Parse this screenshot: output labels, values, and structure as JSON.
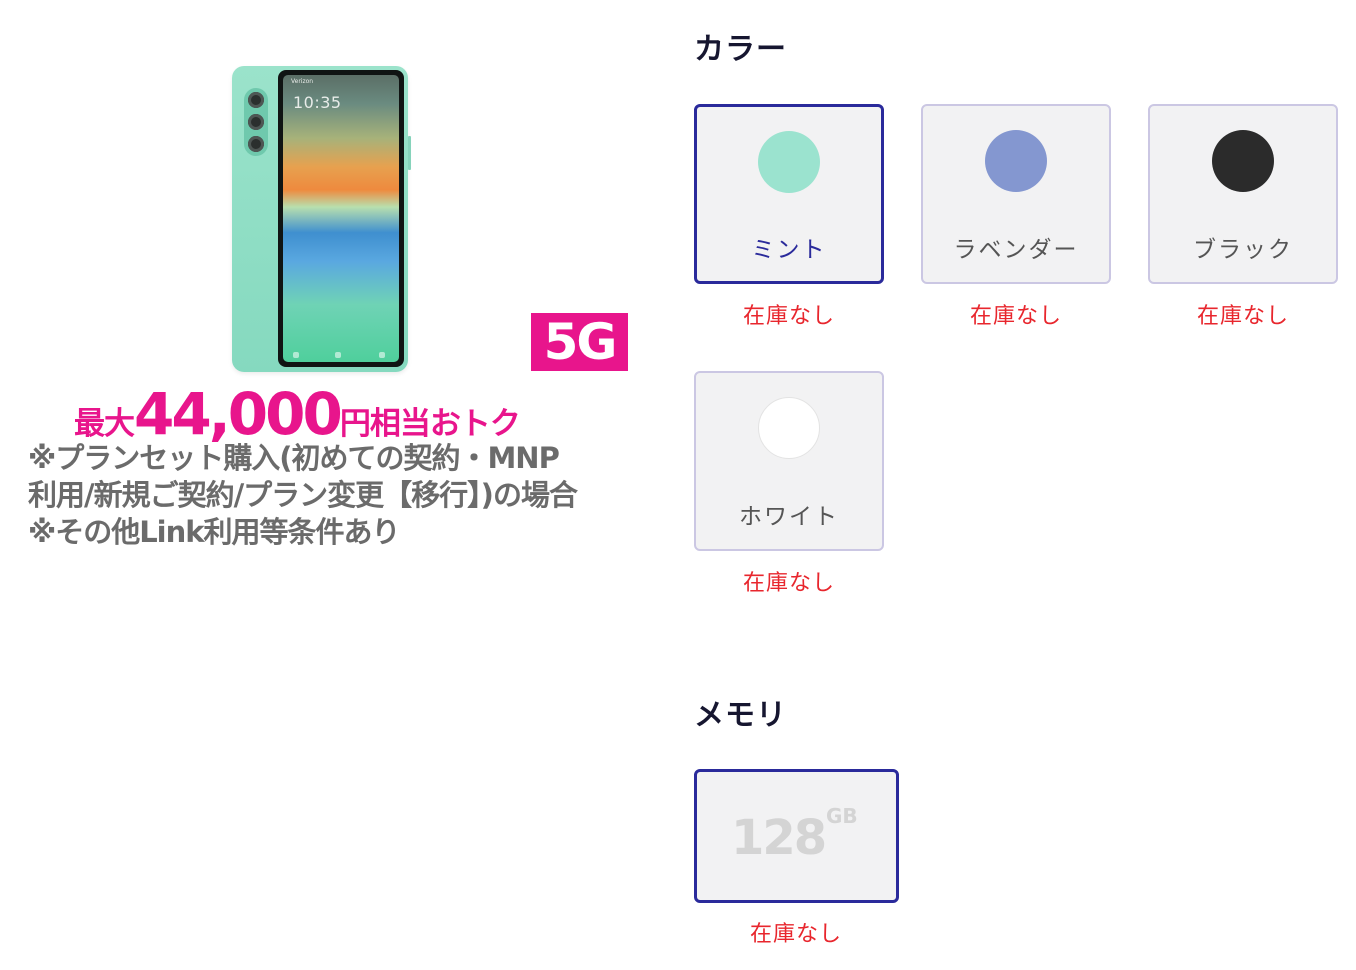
{
  "promo": {
    "clock": "10:35",
    "status": "Verizon",
    "badge": "5G",
    "deal_prefix": "最大",
    "deal_amount": "44,000",
    "deal_suffix": "円相当おトク",
    "notes": [
      "※プランセット購入(初めての契約・MNP",
      "利用/新規ご契約/プラン変更【移行】)の場合",
      "※その他Link利用等条件あり"
    ]
  },
  "color_section": {
    "title": "カラー",
    "options": [
      {
        "label": "ミント",
        "swatch": "#9be3cf",
        "stock": "在庫なし",
        "selected": true
      },
      {
        "label": "ラベンダー",
        "swatch": "#8497d0",
        "stock": "在庫なし",
        "selected": false
      },
      {
        "label": "ブラック",
        "swatch": "#2b2b2b",
        "stock": "在庫なし",
        "selected": false
      },
      {
        "label": "ホワイト",
        "swatch": "#ffffff",
        "stock": "在庫なし",
        "selected": false
      }
    ]
  },
  "memory_section": {
    "title": "メモリ",
    "option": {
      "value": "128",
      "unit": "GB",
      "stock": "在庫なし",
      "selected": true
    }
  },
  "colors": {
    "brand_pink": "#e8158c",
    "selected_border": "#2a2a9b",
    "stock_red": "#e8262d"
  }
}
